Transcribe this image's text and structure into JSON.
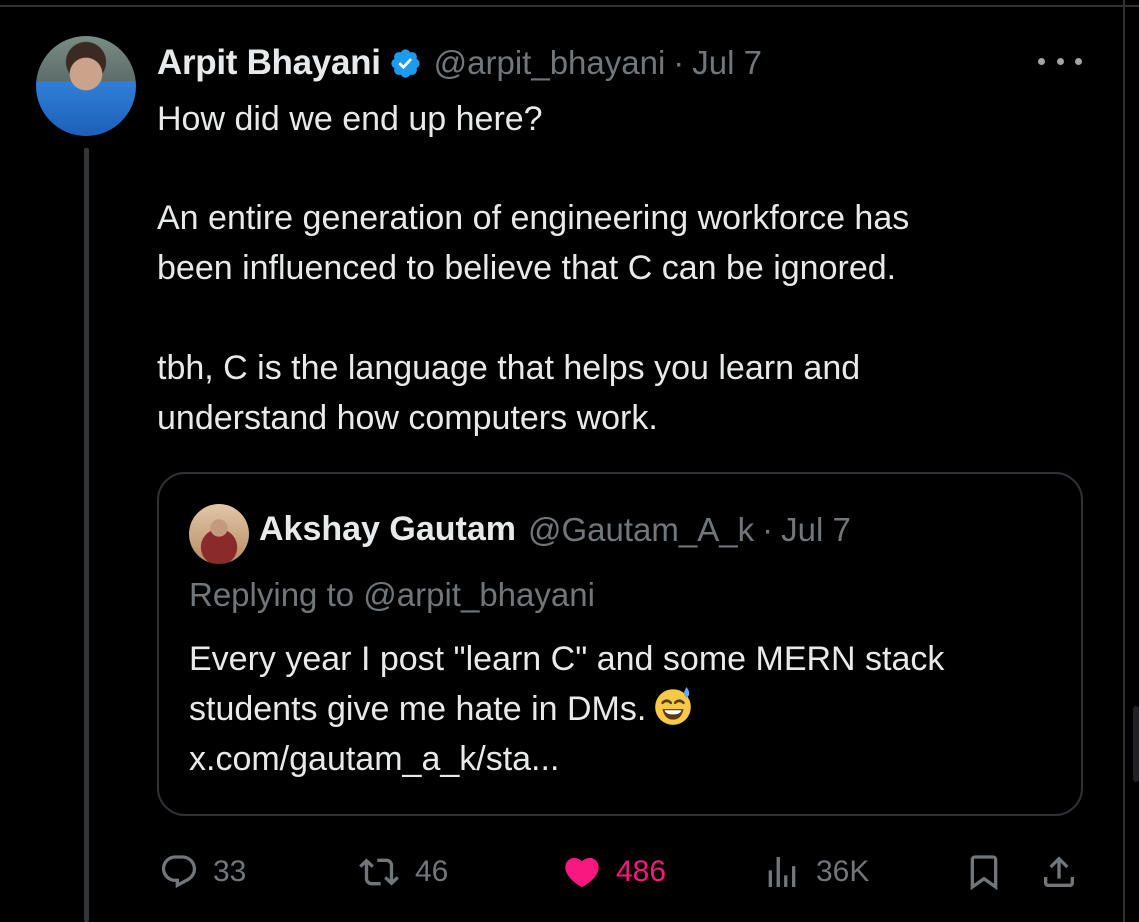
{
  "author": {
    "name": "Arpit Bhayani",
    "handle": "@arpit_bhayani",
    "separator": "·",
    "date": "Jul 7"
  },
  "tweet": {
    "lines": [
      "How did we end up here?",
      "An entire generation of engineering workforce has",
      "been influenced to believe that C can be ignored.",
      "tbh, C is the language that helps you learn and",
      "understand how computers work."
    ]
  },
  "quote": {
    "name": "Akshay Gautam",
    "handle": "@Gautam_A_k",
    "separator": "·",
    "date": "Jul 7",
    "replying_to": "Replying to @arpit_bhayani",
    "lines": [
      "Every year I post \"learn C\" and some MERN stack",
      "students give me hate in DMs.",
      "x.com/gautam_a_k/sta..."
    ]
  },
  "actions": {
    "replies": "33",
    "retweets": "46",
    "likes": "486",
    "views": "36K"
  },
  "colors": {
    "background": "#000000",
    "text": "#e7e9ea",
    "muted": "#71767b",
    "verified": "#1d9bf0",
    "like": "#f91880",
    "border": "#2f3336"
  },
  "icons": [
    "verified-badge-icon",
    "more-icon",
    "reply-icon",
    "retweet-icon",
    "like-heart-icon",
    "views-icon",
    "bookmark-icon",
    "share-icon",
    "sweat-smile-emoji-icon"
  ]
}
